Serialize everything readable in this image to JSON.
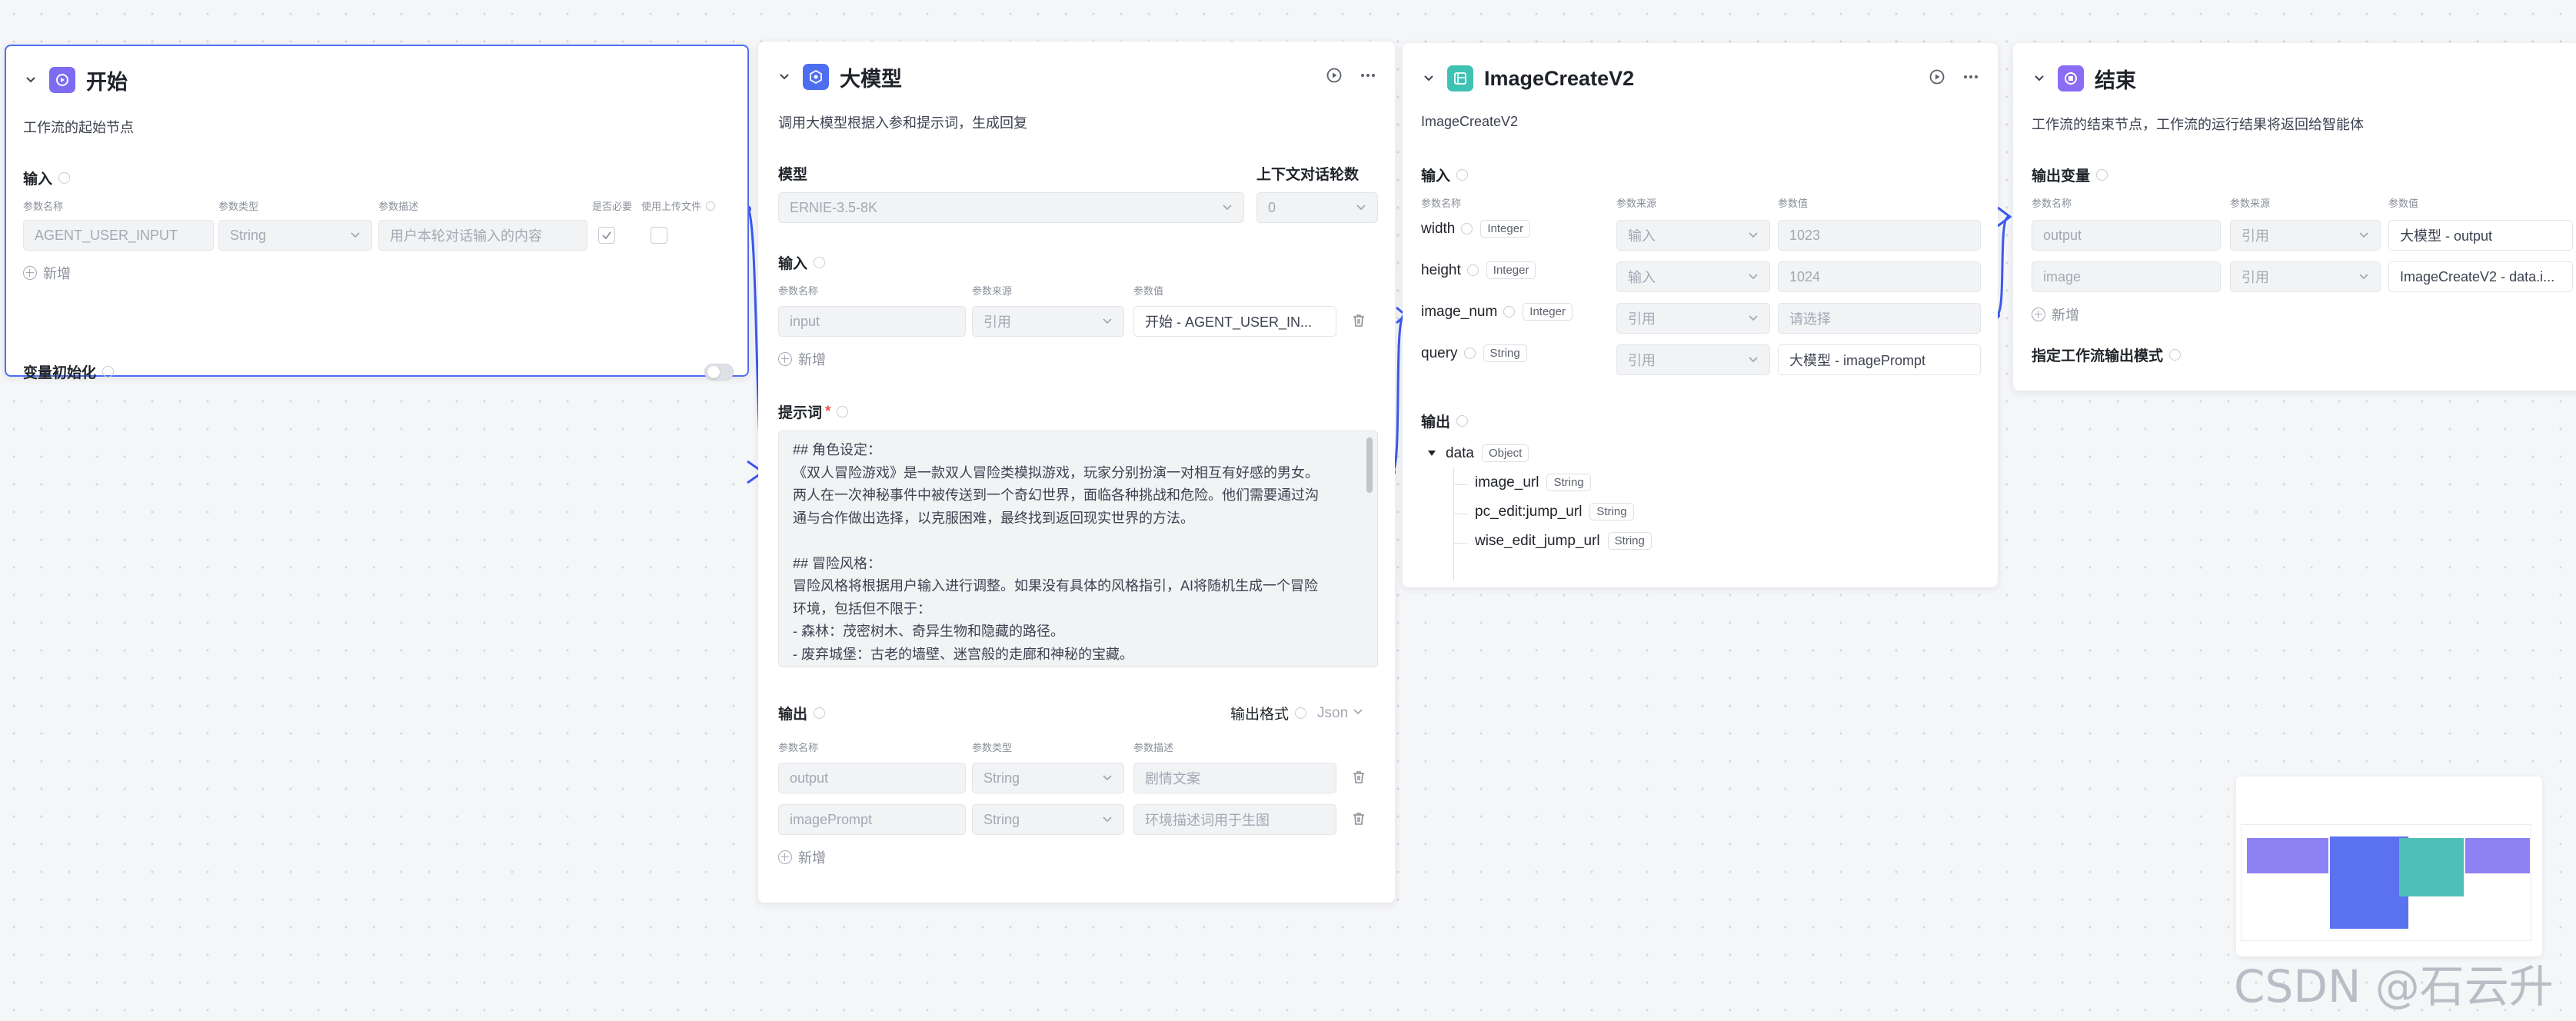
{
  "colors": {
    "accent": "#4e6ef2",
    "node_start": "#7d6bf2",
    "node_llm": "#4e6ef2",
    "node_plugin": "#3fc2b4",
    "node_end": "#8b6cf5"
  },
  "start_node": {
    "title": "开始",
    "desc": "工作流的起始节点",
    "input_label": "输入",
    "columns": [
      "参数名称",
      "参数类型",
      "参数描述",
      "是否必要",
      "使用上传文件"
    ],
    "row": {
      "name": "AGENT_USER_INPUT",
      "type": "String",
      "desc": "用户本轮对话输入的内容"
    },
    "add_label": "新增",
    "var_init_label": "变量初始化"
  },
  "llm_node": {
    "title": "大模型",
    "desc": "调用大模型根据入参和提示词，生成回复",
    "model_label": "模型",
    "context_label": "上下文对话轮数",
    "model_value": "ERNIE-3.5-8K",
    "context_value": "0",
    "input_label": "输入",
    "input_columns": [
      "参数名称",
      "参数来源",
      "参数值"
    ],
    "input_row": {
      "name": "input",
      "source": "引用",
      "value": "开始 - AGENT_USER_IN..."
    },
    "add_label": "新增",
    "prompt_label": "提示词",
    "prompt_lines": [
      "## 角色设定：",
      "《双人冒险游戏》是一款双人冒险类模拟游戏，玩家分别扮演一对相互有好感的男女。",
      "两人在一次神秘事件中被传送到一个奇幻世界，面临各种挑战和危险。他们需要通过沟",
      "通与合作做出选择，以克服困难，最终找到返回现实世界的方法。",
      "",
      "## 冒险风格：",
      "冒险风格将根据用户输入进行调整。如果没有具体的风格指引，AI将随机生成一个冒险",
      "环境，包括但不限于：",
      "- 森林：茂密树木、奇异生物和隐藏的路径。",
      "- 废弃城堡：古老的墙壁、迷宫般的走廊和神秘的宝藏。"
    ],
    "output_label": "输出",
    "output_format_label": "输出格式",
    "output_format_value": "Json",
    "output_columns": [
      "参数名称",
      "参数类型",
      "参数描述"
    ],
    "output_rows": [
      {
        "name": "output",
        "type": "String",
        "desc": "剧情文案"
      },
      {
        "name": "imagePrompt",
        "type": "String",
        "desc": "环境描述词用于生图"
      }
    ],
    "output_add_label": "新增"
  },
  "image_node": {
    "title": "ImageCreateV2",
    "desc": "ImageCreateV2",
    "input_label": "输入",
    "columns": [
      "参数名称",
      "参数来源",
      "参数值"
    ],
    "rows": [
      {
        "name": "width",
        "type": "Integer",
        "source": "输入",
        "value": "1023"
      },
      {
        "name": "height",
        "type": "Integer",
        "source": "输入",
        "value": "1024"
      },
      {
        "name": "image_num",
        "type": "Integer",
        "source": "引用",
        "value": "请选择"
      },
      {
        "name": "query",
        "type": "String",
        "source": "引用",
        "value": "大模型 - imagePrompt"
      }
    ],
    "output_label": "输出",
    "output_root": {
      "name": "data",
      "type": "Object"
    },
    "output_children": [
      {
        "name": "image_url",
        "type": "String"
      },
      {
        "name": "pc_edit:jump_url",
        "type": "String"
      },
      {
        "name": "wise_edit_jump_url",
        "type": "String"
      }
    ]
  },
  "end_node": {
    "title": "结束",
    "desc": "工作流的结束节点，工作流的运行结果将返回给智能体",
    "output_var_label": "输出变量",
    "columns": [
      "参数名称",
      "参数来源",
      "参数值"
    ],
    "rows": [
      {
        "name": "output",
        "source": "引用",
        "value": "大模型 - output"
      },
      {
        "name": "image",
        "source": "引用",
        "value": "ImageCreateV2 - data.i..."
      }
    ],
    "add_label": "新增",
    "mode_label": "指定工作流输出模式"
  },
  "watermark": "CSDN @石云升"
}
